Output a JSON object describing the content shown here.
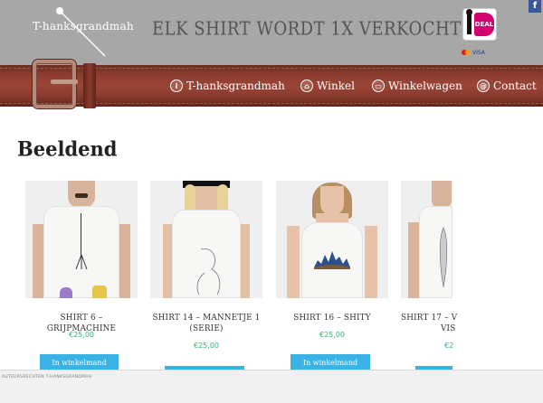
{
  "header": {
    "logo": "T-hanksgrandmah",
    "tagline": "ELK SHIRT WORDT 1X VERKOCHT!",
    "ideal_label": "DEAL",
    "card_brands": [
      "MasterCard",
      "VISA"
    ],
    "social": "f",
    "colors": {
      "header_bg": "#a7a7a7",
      "ideal_pink": "#d4006f",
      "facebook": "#3b5998"
    }
  },
  "nav": {
    "items": [
      {
        "label": "T-hanksgrandmah",
        "icon": "info-icon"
      },
      {
        "label": "Winkel",
        "icon": "home-icon"
      },
      {
        "label": "Winkelwagen",
        "icon": "cart-icon"
      },
      {
        "label": "Contact",
        "icon": "at-icon"
      }
    ],
    "belt_color": "#8e3e30"
  },
  "section": {
    "title": "Beeldend"
  },
  "products": [
    {
      "name": "SHIRT 6 – GRIJPMACHINE",
      "price": "€25,00",
      "button": "In winkelmand"
    },
    {
      "name": "SHIRT 14 – MANNETJE 1 (SERIE)",
      "price": "€25,00",
      "button": "In winkelmand"
    },
    {
      "name": "SHIRT 16 – SHITY",
      "price": "€25,00",
      "button": "In winkelmand"
    },
    {
      "name": "SHIRT 17 – V",
      "name_line2": "VIS",
      "price": "€2",
      "button": ""
    }
  ],
  "button_color": "#3ab2e6",
  "price_color": "#2bb673",
  "footer": {
    "text": "AUTEURSRECHTEN T-HANKSGRANDMAH"
  }
}
